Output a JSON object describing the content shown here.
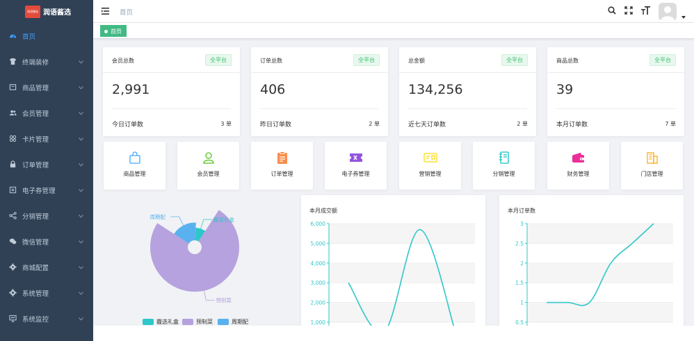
{
  "app": {
    "logo_badge": "润语臻选",
    "name": "润语酱选"
  },
  "sidebar": {
    "items": [
      {
        "label": "首页",
        "icon": "dashboard-icon",
        "active": true
      },
      {
        "label": "终端装修",
        "icon": "tshirt-icon"
      },
      {
        "label": "商品管理",
        "icon": "goods-icon"
      },
      {
        "label": "会员管理",
        "icon": "users-icon"
      },
      {
        "label": "卡片管理",
        "icon": "card-icon"
      },
      {
        "label": "订单管理",
        "icon": "lock-icon"
      },
      {
        "label": "电子券管理",
        "icon": "coupon-icon"
      },
      {
        "label": "分销管理",
        "icon": "share-icon"
      },
      {
        "label": "微信管理",
        "icon": "wechat-icon"
      },
      {
        "label": "商城配置",
        "icon": "gear-icon"
      },
      {
        "label": "系统管理",
        "icon": "settings-icon"
      },
      {
        "label": "系统监控",
        "icon": "monitor-icon"
      }
    ]
  },
  "header": {
    "breadcrumb": "首页"
  },
  "tags": {
    "current": "首页"
  },
  "stats": [
    {
      "title": "会员总数",
      "badge": "全平台",
      "value": "2,991",
      "foot": "今日订单数",
      "count": "3 单"
    },
    {
      "title": "订单总数",
      "badge": "全平台",
      "value": "406",
      "foot": "昨日订单数",
      "count": "2 单"
    },
    {
      "title": "总金额",
      "badge": "全平台",
      "value": "134,256",
      "foot": "近七天订单数",
      "count": "2 单"
    },
    {
      "title": "商品总数",
      "badge": "全平台",
      "value": "39",
      "foot": "本月订单数",
      "count": "7 单"
    }
  ],
  "quick_nav": [
    {
      "label": "商品管理",
      "icon": "bag-icon",
      "color": "#40a9ff"
    },
    {
      "label": "会员管理",
      "icon": "person-icon",
      "color": "#52c41a"
    },
    {
      "label": "订单管理",
      "icon": "clipboard-icon",
      "color": "#fa8c4b"
    },
    {
      "label": "电子券管理",
      "icon": "ticket-icon",
      "color": "#9254de"
    },
    {
      "label": "营销管理",
      "icon": "id-card-icon",
      "color": "#fadb14"
    },
    {
      "label": "分销管理",
      "icon": "notebook-icon",
      "color": "#13c2c2"
    },
    {
      "label": "财务管理",
      "icon": "wallet-icon",
      "color": "#eb2f96"
    },
    {
      "label": "门店管理",
      "icon": "building-icon",
      "color": "#faad14"
    }
  ],
  "chart_data": [
    {
      "type": "pie",
      "title": "",
      "rose": true,
      "series": [
        {
          "name": "霾选礼盒",
          "value": 1,
          "color": "#2ec7c9"
        },
        {
          "name": "预制菜",
          "value": 9,
          "color": "#b6a2de"
        },
        {
          "name": "周期配",
          "value": 2,
          "color": "#5ab1ef"
        }
      ],
      "legend": [
        "霾选礼盒",
        "预制菜",
        "周期配"
      ],
      "legend_position": "bottom"
    },
    {
      "type": "line",
      "title": "本月成交额",
      "ylim": [
        1000,
        6000
      ],
      "yticks": [
        "6,000",
        "5,000",
        "4,000",
        "3,000",
        "2,000",
        "1,000"
      ],
      "series": [
        {
          "values": [
            3000,
            500,
            5700,
            500
          ],
          "color": "#2ec7c9"
        }
      ]
    },
    {
      "type": "line",
      "title": "本月订单数",
      "ylim": [
        0.5,
        3
      ],
      "yticks": [
        "3",
        "2.5",
        "2",
        "1.5",
        "1",
        "0.5"
      ],
      "series": [
        {
          "values": [
            1,
            1,
            1,
            2,
            2.5,
            3
          ],
          "color": "#2ec7c9"
        }
      ]
    }
  ]
}
